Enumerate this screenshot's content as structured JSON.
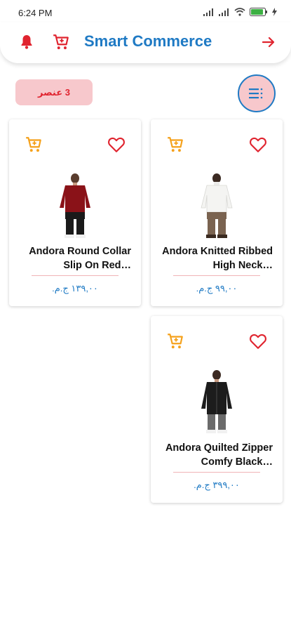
{
  "status_bar": {
    "time": "6:24 PM"
  },
  "header": {
    "title": "Smart Commerce"
  },
  "results": {
    "count_label": "3 عنصر"
  },
  "products": [
    {
      "name": "Andora Round Collar Slip On Red…",
      "price": "١٣٩,٠٠ ج.م.",
      "sweater_color": "#8a1218"
    },
    {
      "name": "Andora Knitted Ribbed High Neck…",
      "price": "٩٩,٠٠ ج.م.",
      "sweater_color": "#f4f4f2"
    },
    {
      "name": "Andora Quilted Zipper Comfy Black…",
      "price": "٣٩٩,٠٠ ج.م.",
      "sweater_color": "#1c1c1c"
    }
  ],
  "colors": {
    "brand_blue": "#1f7ac4",
    "accent_red": "#e0242f",
    "cart_orange": "#f5a11b",
    "badge_pink": "#f7c8cc"
  },
  "icons": [
    "bell-icon",
    "cart-icon",
    "arrow-right-icon",
    "filter-list-icon",
    "add-to-cart-icon",
    "heart-icon"
  ]
}
